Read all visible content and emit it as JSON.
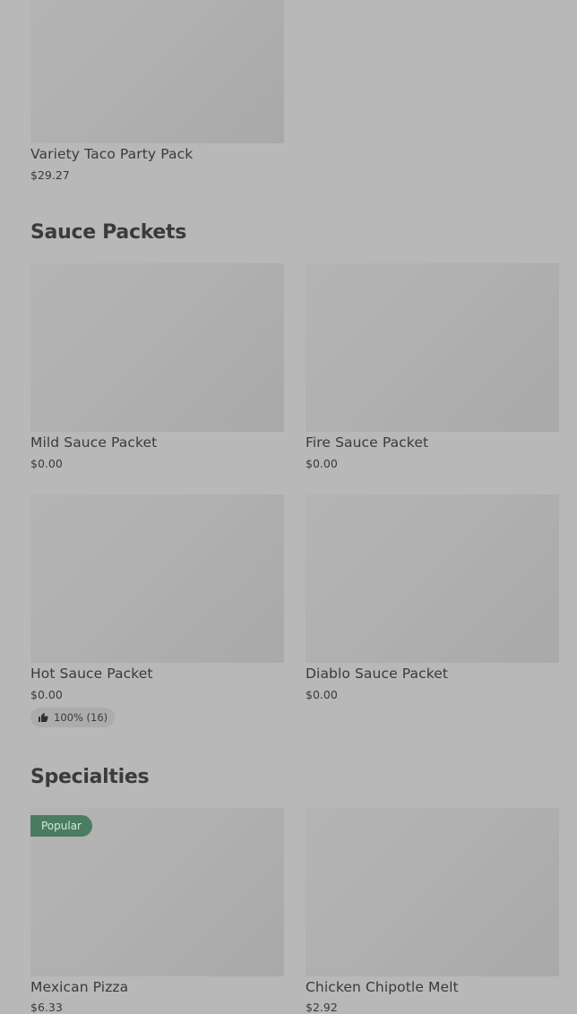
{
  "sections": {
    "top": {
      "items": [
        {
          "name": "Variety Taco Party Pack",
          "price": "$29.27"
        }
      ]
    },
    "sauce_packets": {
      "heading": "Sauce Packets",
      "items": [
        {
          "name": "Mild Sauce Packet",
          "price": "$0.00"
        },
        {
          "name": "Fire Sauce Packet",
          "price": "$0.00"
        },
        {
          "name": "Hot Sauce Packet",
          "price": "$0.00",
          "rating": "100% (16)"
        },
        {
          "name": "Diablo Sauce Packet",
          "price": "$0.00"
        }
      ]
    },
    "specialties": {
      "heading": "Specialties",
      "items": [
        {
          "name": "Mexican Pizza",
          "price": "$6.33",
          "badge": "Popular"
        },
        {
          "name": "Chicken Chipotle Melt",
          "price": "$2.92"
        }
      ]
    }
  },
  "colors": {
    "overlay_background": "#b8b8b8",
    "badge": "#4a7d5f"
  },
  "icons": {
    "rating": "thumbs-up-icon"
  }
}
